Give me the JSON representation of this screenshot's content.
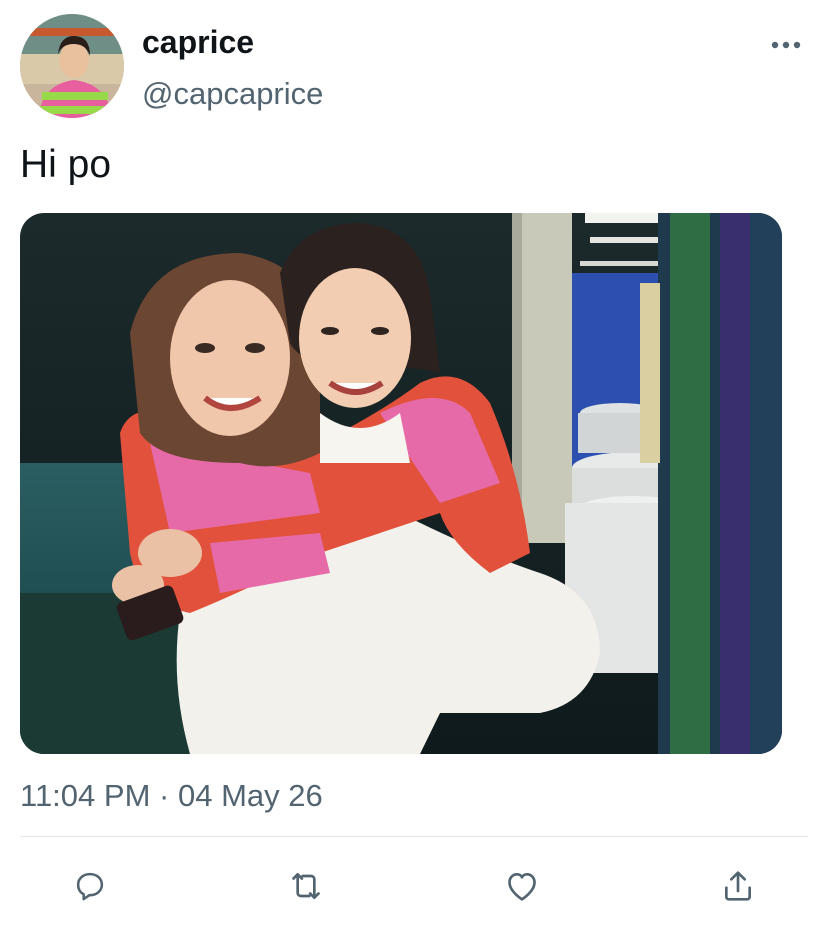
{
  "tweet": {
    "author": {
      "display_name": "caprice",
      "handle": "@capcaprice",
      "avatar": "profile-photo"
    },
    "text": "Hi po",
    "media": {
      "type": "photo",
      "description_icon": "photo"
    },
    "timestamp": {
      "time": "11:04 PM",
      "separator": "·",
      "date": "04 May 26"
    }
  },
  "header": {
    "more_icon": "more-horizontal-icon"
  },
  "actions": [
    {
      "name": "reply",
      "icon": "reply-icon"
    },
    {
      "name": "retweet",
      "icon": "retweet-icon"
    },
    {
      "name": "like",
      "icon": "heart-icon"
    },
    {
      "name": "share",
      "icon": "share-icon"
    }
  ],
  "colors": {
    "text_primary": "#0f1419",
    "text_secondary": "#536471",
    "icon": "#536471",
    "divider": "#e1e8ed"
  }
}
